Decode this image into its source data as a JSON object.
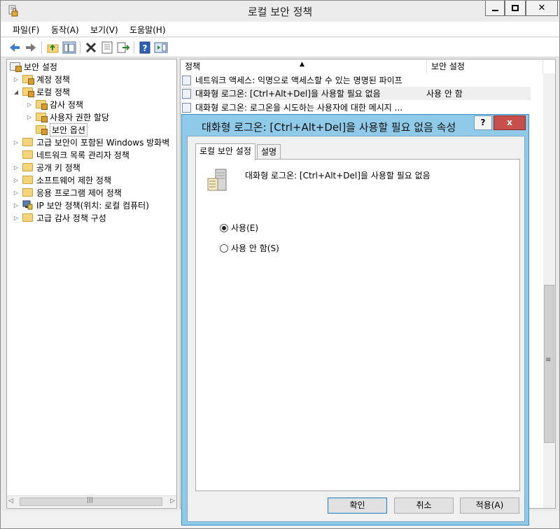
{
  "window": {
    "title": "로컬 보안 정책"
  },
  "menu": [
    "파일(F)",
    "동작(A)",
    "보기(V)",
    "도움말(H)"
  ],
  "toolbar": {
    "buttons": [
      "back-icon",
      "forward-icon",
      "up-folder-icon",
      "show-hide-tree-icon",
      "delete-icon",
      "properties-icon",
      "export-list-icon",
      "help-icon",
      "show-hide-action-pane-icon"
    ]
  },
  "tree": {
    "root": "보안 설정",
    "items": [
      {
        "label": "계정 정책"
      },
      {
        "label": "로컬 정책"
      },
      {
        "label": "감사 정책"
      },
      {
        "label": "사용자 권한 할당"
      },
      {
        "label": "보안 옵션"
      },
      {
        "label": "고급 보안이 포함된 Windows 방화벽"
      },
      {
        "label": "네트워크 목록 관리자 정책"
      },
      {
        "label": "공개 키 정책"
      },
      {
        "label": "소프트웨어 제한 정책"
      },
      {
        "label": "응용 프로그램 제어 정책"
      },
      {
        "label": "IP 보안 정책(위치: 로컬 컴퓨터)"
      },
      {
        "label": "고급 감사 정책 구성"
      }
    ]
  },
  "list": {
    "columns": [
      "정책",
      "보안 설정"
    ],
    "rows": [
      {
        "policy": "네트워크 액세스: 익명으로 액세스할 수 있는 명명된 파이프",
        "setting": ""
      },
      {
        "policy": "대화형 로그온: [Ctrl+Alt+Del]을 사용할 필요 없음",
        "setting": "사용 안 함"
      },
      {
        "policy": "대화형 로그온: 로그온을 시도하는 사용자에 대한 메시지 ...",
        "setting": ""
      }
    ]
  },
  "dialog": {
    "title": "대화형 로그온: [Ctrl+Alt+Del]을 사용할 필요 없음 속성",
    "help": "?",
    "close": "x",
    "tabs": [
      "로컬 보안 설정",
      "설명"
    ],
    "policy_name": "대화형 로그온: [Ctrl+Alt+Del]을 사용할 필요 없음",
    "options": [
      {
        "label": "사용(E)",
        "checked": true
      },
      {
        "label": "사용 안 함(S)",
        "checked": false
      }
    ],
    "buttons": {
      "ok": "확인",
      "cancel": "취소",
      "apply": "적용(A)"
    }
  }
}
